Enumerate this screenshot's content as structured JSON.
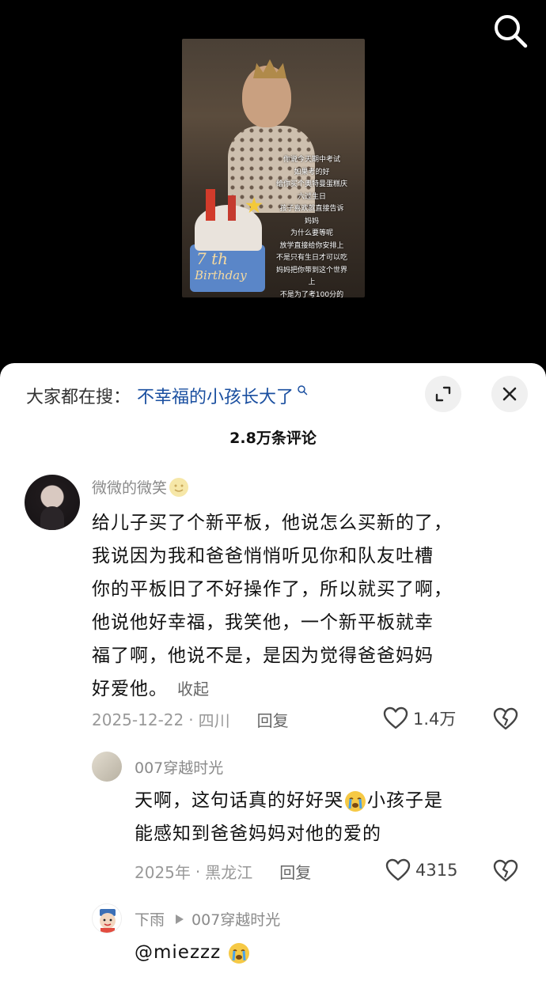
{
  "video": {
    "caption_lines": [
      "你说今天期中考试",
      "如果考的好",
      "给你买个奥特曼蛋糕庆",
      "六过生日",
      "孩子喜欢就直接告诉",
      "妈妈",
      "为什么要等呢",
      "放学直接给你安排上",
      "不是只有生日才可以吃",
      "妈妈把你带到这个世界",
      "上",
      "不是为了考100分的"
    ],
    "cake_text_1": "7 th",
    "cake_text_2": "Birthday"
  },
  "sheet": {
    "search_label": "大家都在搜：",
    "search_term": "不幸福的小孩长大了",
    "comment_count": "2.8万条评论"
  },
  "comments": [
    {
      "name": "微微的微笑",
      "lines": [
        "给儿子买了个新平板，他说怎么买新的了，",
        "我说因为我和爸爸悄悄听见你和队友吐槽",
        "你的平板旧了不好操作了，所以就买了啊，",
        "他说他好幸福，我笑他，一个新平板就幸",
        "福了啊，他说不是，是因为觉得爸爸妈妈",
        "好爱他。"
      ],
      "collapse": "收起",
      "date": "2025-12-22",
      "location": "四川",
      "reply": "回复",
      "likes": "1.4万"
    },
    {
      "name": "007穿越时光",
      "line1_a": "天啊，这句话真的好好哭",
      "line1_b": "小孩子是",
      "line2": "能感知到爸爸妈妈对他的爱的",
      "date": "2025年",
      "location": "黑龙江",
      "reply": "回复",
      "likes": "4315"
    },
    {
      "name": "下雨",
      "reply_to": "007穿越时光",
      "text": "@miezzz"
    }
  ],
  "meta_separator": "·"
}
